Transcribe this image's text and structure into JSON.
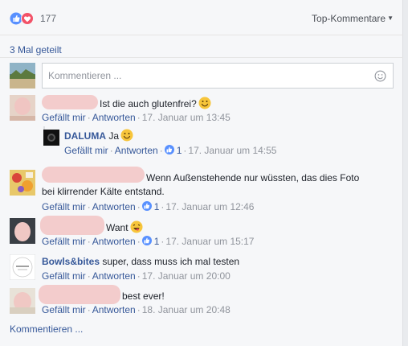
{
  "reactions": {
    "count": "177",
    "sort_label": "Top-Kommentare"
  },
  "shares_text": "3 Mal geteilt",
  "compose": {
    "placeholder": "Kommentieren ..."
  },
  "comments": [
    {
      "text": "Ist die auch glutenfrei?",
      "like": "Gefällt mir",
      "reply": "Antworten",
      "date": "17. Januar um 13:45"
    },
    {
      "author": "DALUMA",
      "text": "Ja",
      "like": "Gefällt mir",
      "reply": "Antworten",
      "like_count": "1",
      "date": "17. Januar um 14:55"
    },
    {
      "text": "Wenn Außenstehende nur wüssten, das dies Foto",
      "text2": "bei klirrender Kälte entstand.",
      "like": "Gefällt mir",
      "reply": "Antworten",
      "like_count": "1",
      "date": "17. Januar um 12:46"
    },
    {
      "text": "Want",
      "like": "Gefällt mir",
      "reply": "Antworten",
      "like_count": "1",
      "date": "17. Januar um 15:17"
    },
    {
      "author": "Bowls&bites",
      "text": "super, dass muss ich mal testen",
      "like": "Gefällt mir",
      "reply": "Antworten",
      "date": "17. Januar um 20:00"
    },
    {
      "text": "best ever!",
      "like": "Gefällt mir",
      "reply": "Antworten",
      "date": "18. Januar um 20:48"
    }
  ],
  "footer": {
    "comment_link": "Kommentieren ..."
  },
  "colors": {
    "link": "#365899",
    "meta": "#90949c",
    "like_blue": "#5890ff",
    "love_red": "#f25268",
    "smiley_yellow": "#f7c53b"
  }
}
